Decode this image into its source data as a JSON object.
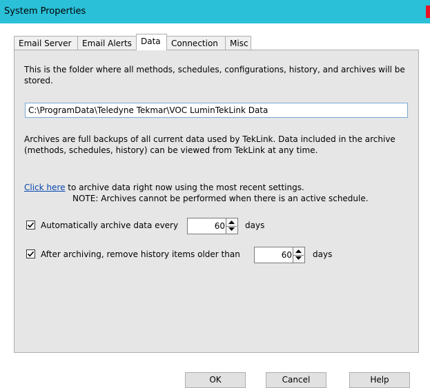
{
  "window": {
    "title": "System Properties"
  },
  "tabs": [
    {
      "label": "Email Server"
    },
    {
      "label": "Email Alerts"
    },
    {
      "label": "Data"
    },
    {
      "label": "Connection"
    },
    {
      "label": "Misc"
    }
  ],
  "data_tab": {
    "folder_description": "This is the folder where all methods, schedules, configurations, history, and archives will be stored.",
    "folder_path": "C:\\ProgramData\\Teledyne Tekmar\\VOC LuminTekLink Data",
    "archives_description": "Archives are full backups of all current data used by TekLink.  Data included in the archive (methods, schedules, history) can be viewed from TekLink at any time.",
    "click_here_link": "Click here",
    "archive_now_text": "to archive data right now using the most recent settings.",
    "note_text": "NOTE: Archives cannot be performed when there is an active schedule.",
    "auto_archive": {
      "label": "Automatically archive data every",
      "checked": true,
      "value": "60",
      "unit": "days"
    },
    "remove_history": {
      "label": "After archiving, remove history items older than",
      "checked": true,
      "value": "60",
      "unit": "days"
    }
  },
  "buttons": {
    "ok": "OK",
    "cancel": "Cancel",
    "help": "Help"
  }
}
